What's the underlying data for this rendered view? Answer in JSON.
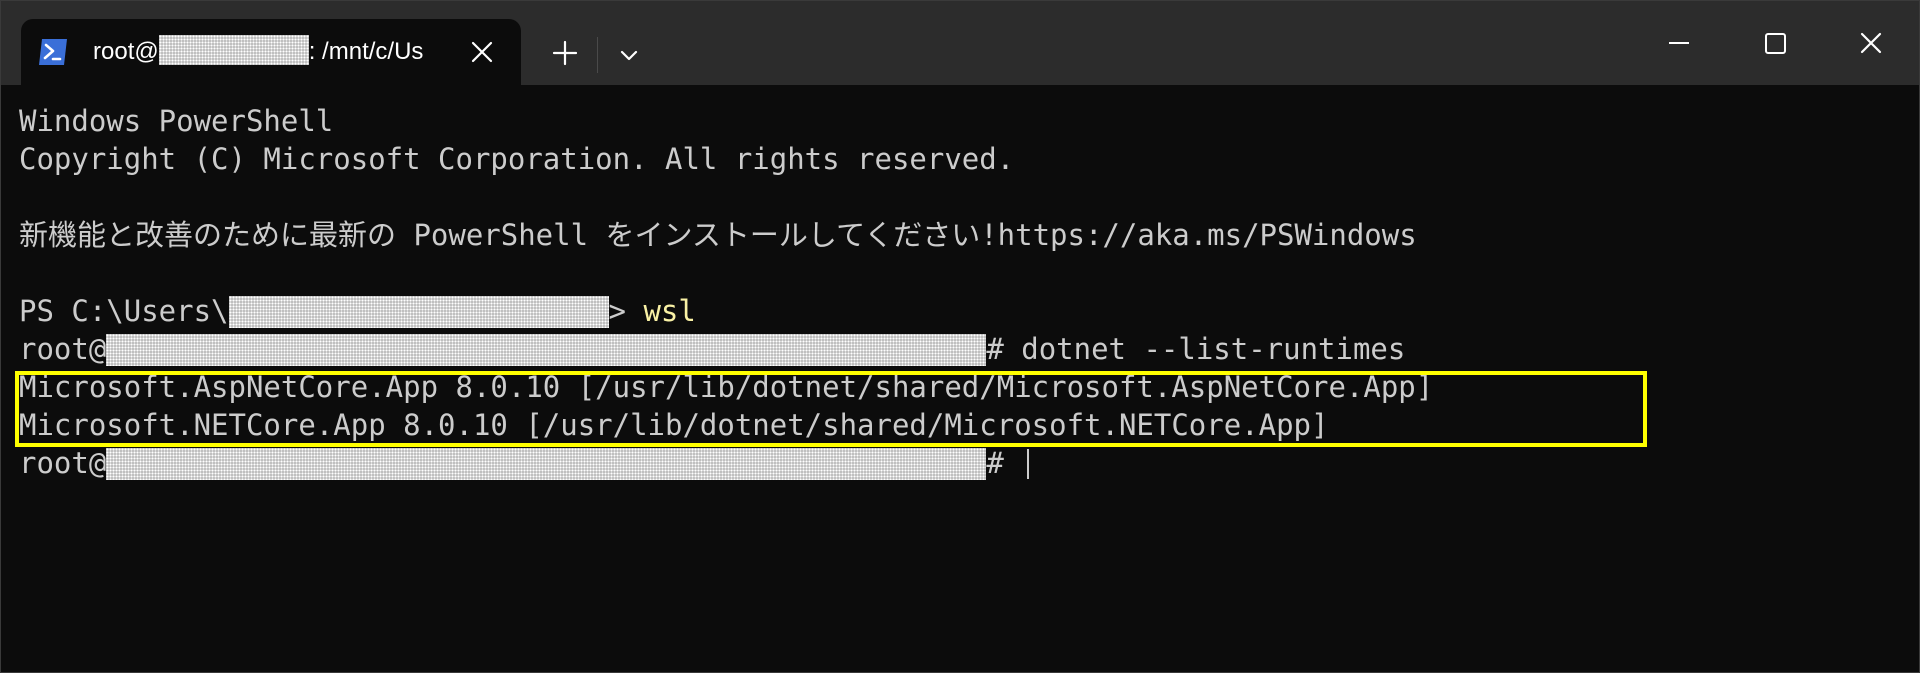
{
  "tab": {
    "title_prefix": "root@",
    "title_suffix": ": /mnt/c/Us",
    "icon": "powershell-icon"
  },
  "titlebar": {
    "new_tab_icon": "plus-icon",
    "dropdown_icon": "chevron-down-icon",
    "minimize_icon": "minimize-icon",
    "maximize_icon": "maximize-icon",
    "close_icon": "close-icon"
  },
  "terminal": {
    "line1": "Windows PowerShell",
    "line2": "Copyright (C) Microsoft Corporation. All rights reserved.",
    "line3": "新機能と改善のために最新の PowerShell をインストールしてください!https://aka.ms/PSWindows",
    "ps_prompt_prefix": "PS C:\\Users\\",
    "ps_prompt_suffix": "> ",
    "ps_command": "wsl",
    "root_prefix": "root@",
    "root_prompt_suffix": "# ",
    "root_command": "dotnet --list-runtimes",
    "output1": "Microsoft.AspNetCore.App 8.0.10 [/usr/lib/dotnet/shared/Microsoft.AspNetCore.App]",
    "output2": "Microsoft.NETCore.App 8.0.10 [/usr/lib/dotnet/shared/Microsoft.NETCore.App]"
  },
  "colors": {
    "background": "#0c0c0c",
    "titlebar": "#2c2c2c",
    "text": "#cccccc",
    "command": "#f9f1a5",
    "highlight": "#ffff00"
  }
}
